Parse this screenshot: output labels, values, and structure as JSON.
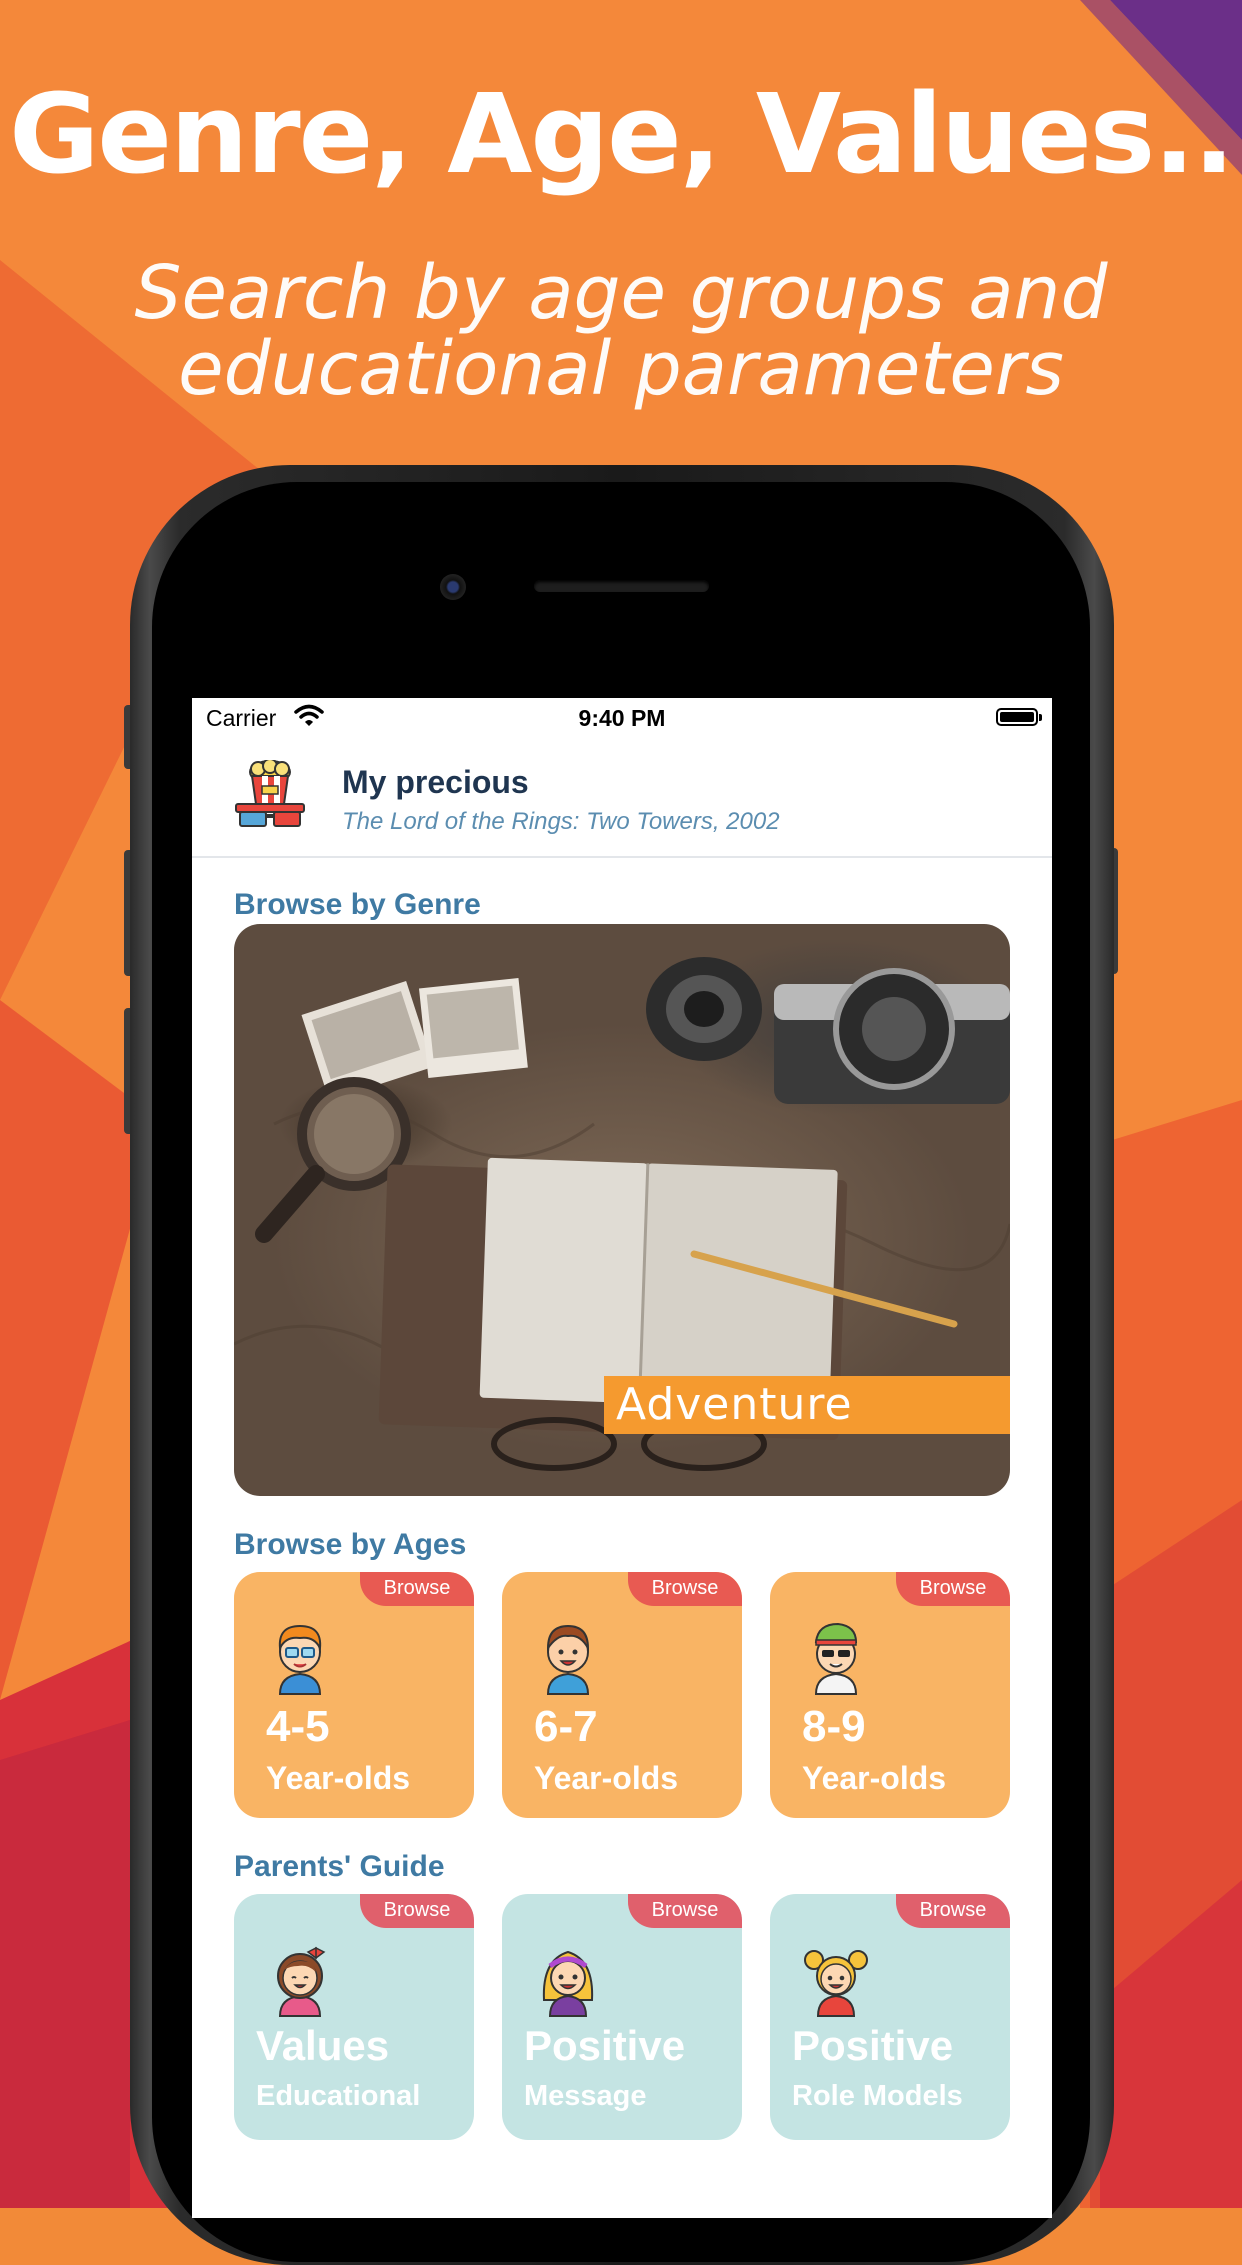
{
  "marketing": {
    "headline": "Genre, Age, Values..",
    "subhead_line1": "Search by age groups and",
    "subhead_line2": "educational parameters"
  },
  "status_bar": {
    "carrier": "Carrier",
    "time": "9:40 PM"
  },
  "header": {
    "icon": "cinema-popcorn-3d-glasses-icon",
    "title": "My precious",
    "subtitle": "The Lord of the Rings: Two Towers, 2002"
  },
  "genre_section": {
    "title": "Browse by Genre",
    "card_label": "Adventure"
  },
  "ages_section": {
    "title": "Browse by Ages",
    "tiles": [
      {
        "badge": "Browse",
        "range": "4-5",
        "caption": "Year-olds",
        "icon": "boy-glasses-icon"
      },
      {
        "badge": "Browse",
        "range": "6-7",
        "caption": "Year-olds",
        "icon": "boy-smiling-icon"
      },
      {
        "badge": "Browse",
        "range": "8-9",
        "caption": "Year-olds",
        "icon": "boy-cap-sunglasses-icon"
      }
    ]
  },
  "guide_section": {
    "title": "Parents' Guide",
    "tiles": [
      {
        "badge": "Browse",
        "title": "Values",
        "caption": "Educational",
        "icon": "girl-bow-icon"
      },
      {
        "badge": "Browse",
        "title": "Positive",
        "caption": "Message",
        "icon": "girl-headband-icon"
      },
      {
        "badge": "Browse",
        "title": "Positive",
        "caption": "Role Models",
        "icon": "girl-pigtails-icon"
      }
    ]
  },
  "colors": {
    "background_orange": "#f28a38",
    "age_tile": "#f9b464",
    "guide_tile": "#c4e4e3",
    "browse_badge": "#e85a52",
    "section_title": "#3f7aa3",
    "genre_label": "#f59a2f"
  }
}
